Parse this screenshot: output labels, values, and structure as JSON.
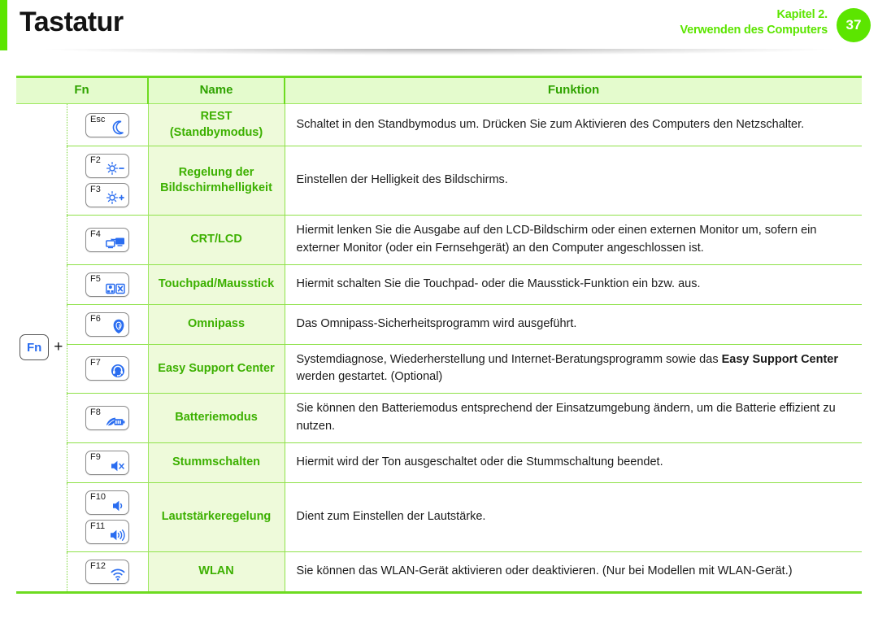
{
  "header": {
    "title": "Tastatur",
    "chapter_line1": "Kapitel 2.",
    "chapter_line2": "Verwenden des Computers",
    "page_number": "37",
    "accent_color": "#5ce500"
  },
  "table": {
    "columns": [
      "Fn",
      "Name",
      "Funktion"
    ],
    "modifier": {
      "key_label": "Fn",
      "plus": "+"
    },
    "rows": [
      {
        "keys": [
          {
            "label": "Esc",
            "icon": "moon-icon"
          }
        ],
        "name_lines": [
          "REST",
          "(Standbymodus)"
        ],
        "desc_parts": [
          {
            "text": "Schaltet in den Standbymodus um. Drücken Sie zum Aktivieren des Computers den Netzschalter.",
            "bold": false
          }
        ]
      },
      {
        "keys": [
          {
            "label": "F2",
            "icon": "brightness-down-icon"
          },
          {
            "label": "F3",
            "icon": "brightness-up-icon"
          }
        ],
        "name_lines": [
          "Regelung der",
          "Bildschirmhelligkeit"
        ],
        "desc_parts": [
          {
            "text": "Einstellen der Helligkeit des Bildschirms.",
            "bold": false
          }
        ]
      },
      {
        "keys": [
          {
            "label": "F4",
            "icon": "dual-display-icon"
          }
        ],
        "name_lines": [
          "CRT/LCD"
        ],
        "desc_parts": [
          {
            "text": "Hiermit lenken Sie die Ausgabe auf den LCD-Bildschirm oder einen externen Monitor um, sofern ein externer Monitor (oder ein Fernsehgerät) an den Computer angeschlossen ist.",
            "bold": false
          }
        ]
      },
      {
        "keys": [
          {
            "label": "F5",
            "icon": "touchpad-icon"
          }
        ],
        "name_lines": [
          "Touchpad/Mausstick"
        ],
        "desc_parts": [
          {
            "text": "Hiermit schalten Sie die Touchpad- oder die Mausstick-Funktion ein bzw. aus.",
            "bold": false
          }
        ]
      },
      {
        "keys": [
          {
            "label": "F6",
            "icon": "fingerprint-icon"
          }
        ],
        "name_lines": [
          "Omnipass"
        ],
        "desc_parts": [
          {
            "text": "Das Omnipass-Sicherheitsprogramm wird ausgeführt.",
            "bold": false
          }
        ]
      },
      {
        "keys": [
          {
            "label": "F7",
            "icon": "headset-support-icon"
          }
        ],
        "name_lines": [
          "Easy Support Center"
        ],
        "desc_parts": [
          {
            "text": "Systemdiagnose, Wiederherstellung und Internet-Beratungsprogramm sowie das ",
            "bold": false
          },
          {
            "text": "Easy Support Center",
            "bold": true
          },
          {
            "text": " werden gestartet. (Optional)",
            "bold": false
          }
        ]
      },
      {
        "keys": [
          {
            "label": "F8",
            "icon": "battery-leaf-icon"
          }
        ],
        "name_lines": [
          "Batteriemodus"
        ],
        "desc_parts": [
          {
            "text": "Sie können den Batteriemodus entsprechend der Einsatzumgebung ändern, um die Batterie effizient zu nutzen.",
            "bold": false
          }
        ]
      },
      {
        "keys": [
          {
            "label": "F9",
            "icon": "mute-icon"
          }
        ],
        "name_lines": [
          "Stummschalten"
        ],
        "desc_parts": [
          {
            "text": "Hiermit wird der Ton ausgeschaltet oder die Stummschaltung beendet.",
            "bold": false
          }
        ]
      },
      {
        "keys": [
          {
            "label": "F10",
            "icon": "volume-down-icon"
          },
          {
            "label": "F11",
            "icon": "volume-up-icon"
          }
        ],
        "name_lines": [
          "Lautstärkeregelung"
        ],
        "desc_parts": [
          {
            "text": "Dient zum Einstellen der Lautstärke.",
            "bold": false
          }
        ]
      },
      {
        "keys": [
          {
            "label": "F12",
            "icon": "wifi-icon"
          }
        ],
        "name_lines": [
          "WLAN"
        ],
        "desc_parts": [
          {
            "text": "Sie können das WLAN-Gerät aktivieren oder deaktivieren. (Nur bei Modellen mit WLAN-Gerät.)",
            "bold": false
          }
        ]
      }
    ]
  }
}
